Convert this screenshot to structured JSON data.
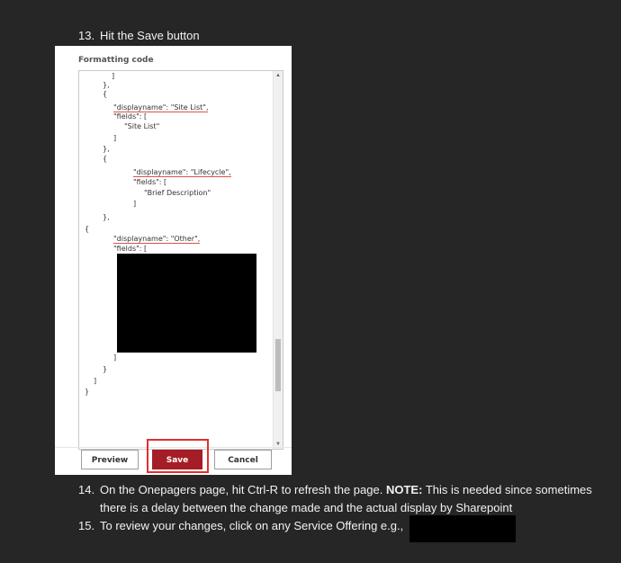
{
  "steps": {
    "s13": {
      "num": "13.",
      "text": "Hit the Save button"
    },
    "s14": {
      "num": "14.",
      "text_a": "On the Onepagers page, hit Ctrl-R to refresh the page.",
      "note_label": "NOTE:",
      "text_b": "This is needed since sometimes",
      "text_c": "there is a delay between the change made and the actual display by Sharepoint"
    },
    "s15": {
      "num": "15.",
      "text": "To review your changes, click on any Service Offering e.g.,"
    }
  },
  "panel": {
    "heading": "Formatting code",
    "code": [
      "]",
      "},",
      "{",
      "\"displayname\": \"Site List\",",
      "\"fields\": [",
      "\"Site List\"",
      "]",
      "},",
      "{",
      "\"displayname\": \"Lifecycle\",",
      "\"fields\": [",
      "\"Brief Description\"",
      "]",
      "},",
      "{",
      "\"displayname\": \"Other\",",
      "\"fields\": [",
      "]",
      "}",
      "]",
      "}"
    ],
    "buttons": {
      "preview": "Preview",
      "save": "Save",
      "cancel": "Cancel"
    },
    "scroll_up_icon": "arrow-up",
    "scroll_down_icon": "arrow-down"
  },
  "colors": {
    "background": "#262626",
    "save_button": "#a51d26",
    "highlight": "#e03030"
  }
}
